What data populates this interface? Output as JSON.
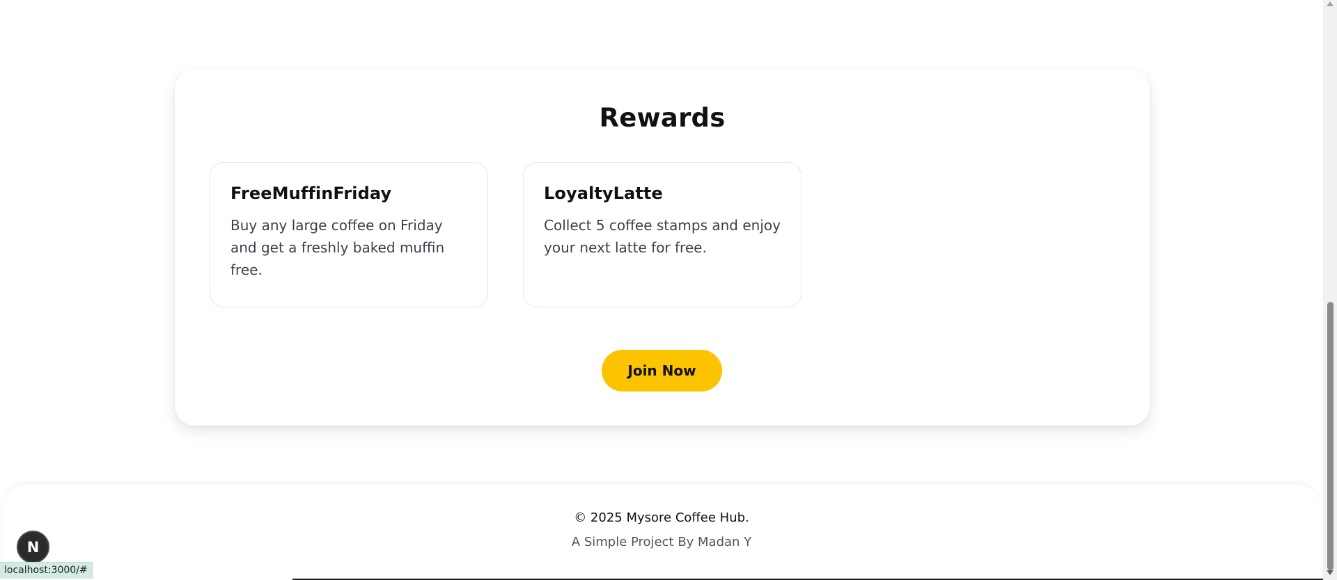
{
  "rewards": {
    "title": "Rewards",
    "items": [
      {
        "name": "FreeMuffinFriday",
        "description": "Buy any large coffee on Friday and get a freshly baked muffin free."
      },
      {
        "name": "LoyaltyLatte",
        "description": "Collect 5 coffee stamps and enjoy your next latte for free."
      }
    ],
    "join_label": "Join Now"
  },
  "footer": {
    "copyright": "© 2025 Mysore Coffee Hub.",
    "credit": "A Simple Project By Madan Y"
  },
  "dev_indicator": {
    "letter": "N",
    "icon": "nextjs-icon"
  },
  "status_bar": {
    "url": "localhost:3000/#"
  },
  "colors": {
    "accent": "#fcc400",
    "text": "#111111",
    "muted": "#4b5563"
  }
}
